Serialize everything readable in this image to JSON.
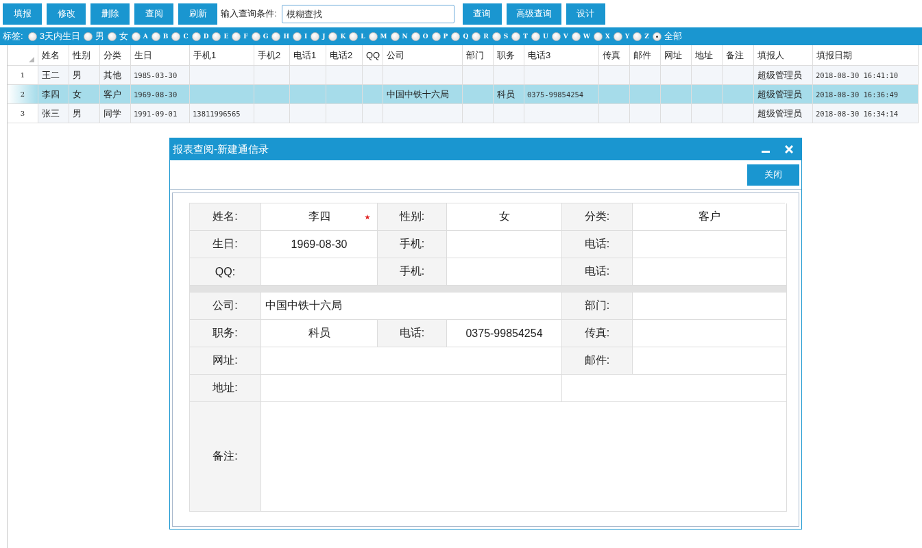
{
  "toolbar": {
    "buttons": [
      "填报",
      "修改",
      "删除",
      "查阅",
      "刷新"
    ],
    "query_label": "输入查询条件:",
    "query_placeholder": "模糊查找",
    "after_buttons": [
      "查询",
      "高级查询",
      "设计"
    ]
  },
  "tag_bar": {
    "label": "标签:",
    "options": [
      {
        "label": "3天内生日",
        "selected": false
      },
      {
        "label": "男",
        "selected": false
      },
      {
        "label": "女",
        "selected": false
      },
      {
        "label": "A",
        "selected": false
      },
      {
        "label": "B",
        "selected": false
      },
      {
        "label": "C",
        "selected": false
      },
      {
        "label": "D",
        "selected": false
      },
      {
        "label": "E",
        "selected": false
      },
      {
        "label": "F",
        "selected": false
      },
      {
        "label": "G",
        "selected": false
      },
      {
        "label": "H",
        "selected": false
      },
      {
        "label": "I",
        "selected": false
      },
      {
        "label": "J",
        "selected": false
      },
      {
        "label": "K",
        "selected": false
      },
      {
        "label": "L",
        "selected": false
      },
      {
        "label": "M",
        "selected": false
      },
      {
        "label": "N",
        "selected": false
      },
      {
        "label": "O",
        "selected": false
      },
      {
        "label": "P",
        "selected": false
      },
      {
        "label": "Q",
        "selected": false
      },
      {
        "label": "R",
        "selected": false
      },
      {
        "label": "S",
        "selected": false
      },
      {
        "label": "T",
        "selected": false
      },
      {
        "label": "U",
        "selected": false
      },
      {
        "label": "V",
        "selected": false
      },
      {
        "label": "W",
        "selected": false
      },
      {
        "label": "X",
        "selected": false
      },
      {
        "label": "Y",
        "selected": false
      },
      {
        "label": "Z",
        "selected": false
      },
      {
        "label": "全部",
        "selected": true
      }
    ]
  },
  "table": {
    "columns": [
      "姓名",
      "性别",
      "分类",
      "生日",
      "手机1",
      "手机2",
      "电话1",
      "电话2",
      "QQ",
      "公司",
      "部门",
      "职务",
      "电话3",
      "传真",
      "邮件",
      "网址",
      "地址",
      "备注",
      "填报人",
      "填报日期"
    ],
    "rows": [
      {
        "number": "1",
        "selected": false,
        "cells": [
          "王二",
          "男",
          "其他",
          "1985-03-30",
          "",
          "",
          "",
          "",
          "",
          "",
          "",
          "",
          "",
          "",
          "",
          "",
          "",
          "",
          "超级管理员",
          "2018-08-30 16:41:10"
        ]
      },
      {
        "number": "2",
        "selected": true,
        "cells": [
          "李四",
          "女",
          "客户",
          "1969-08-30",
          "",
          "",
          "",
          "",
          "",
          "中国中铁十六局",
          "",
          "科员",
          "0375-99854254",
          "",
          "",
          "",
          "",
          "",
          "超级管理员",
          "2018-08-30 16:36:49"
        ]
      },
      {
        "number": "3",
        "selected": false,
        "cells": [
          "张三",
          "男",
          "同学",
          "1991-09-01",
          "13811996565",
          "",
          "",
          "",
          "",
          "",
          "",
          "",
          "",
          "",
          "",
          "",
          "",
          "",
          "超级管理员",
          "2018-08-30 16:34:14"
        ]
      }
    ]
  },
  "dialog": {
    "title": "报表查阅-新建通信录",
    "close_button": "关闭",
    "form_rows": [
      {
        "kind": "fields",
        "cells": [
          {
            "kind": "label",
            "text": "姓名:"
          },
          {
            "kind": "value",
            "text": "李四",
            "required": true
          },
          {
            "kind": "label",
            "text": "性别:"
          },
          {
            "kind": "value",
            "text": "女"
          },
          {
            "kind": "label",
            "text": "分类:"
          },
          {
            "kind": "value",
            "text": "客户"
          }
        ]
      },
      {
        "kind": "fields",
        "cells": [
          {
            "kind": "label",
            "text": "生日:"
          },
          {
            "kind": "value",
            "text": "1969-08-30"
          },
          {
            "kind": "label",
            "text": "手机:"
          },
          {
            "kind": "value"
          },
          {
            "kind": "label",
            "text": "电话:"
          },
          {
            "kind": "value"
          }
        ]
      },
      {
        "kind": "fields",
        "cells": [
          {
            "kind": "label",
            "text": "QQ:"
          },
          {
            "kind": "value"
          },
          {
            "kind": "label",
            "text": "手机:"
          },
          {
            "kind": "value"
          },
          {
            "kind": "label",
            "text": "电话:"
          },
          {
            "kind": "value"
          }
        ]
      },
      {
        "kind": "divider"
      },
      {
        "kind": "fields",
        "cells": [
          {
            "kind": "label",
            "text": "公司:"
          },
          {
            "kind": "wide",
            "text": "中国中铁十六局"
          },
          {
            "kind": "label",
            "text": "部门:"
          },
          {
            "kind": "value"
          }
        ]
      },
      {
        "kind": "fields",
        "cells": [
          {
            "kind": "label",
            "text": "职务:"
          },
          {
            "kind": "value",
            "text": "科员"
          },
          {
            "kind": "label",
            "text": "电话:"
          },
          {
            "kind": "value",
            "text": "0375-99854254"
          },
          {
            "kind": "label",
            "text": "传真:"
          },
          {
            "kind": "value"
          }
        ]
      },
      {
        "kind": "fields",
        "cells": [
          {
            "kind": "label",
            "text": "网址:"
          },
          {
            "kind": "wide"
          },
          {
            "kind": "label",
            "text": "邮件:"
          },
          {
            "kind": "value"
          }
        ]
      },
      {
        "kind": "fields",
        "cells": [
          {
            "kind": "label",
            "text": "地址:"
          },
          {
            "kind": "wide"
          },
          {
            "kind": "half"
          }
        ]
      },
      {
        "kind": "notes",
        "cells": [
          {
            "kind": "label",
            "text": "备注:"
          },
          {
            "kind": "full"
          }
        ]
      }
    ]
  }
}
